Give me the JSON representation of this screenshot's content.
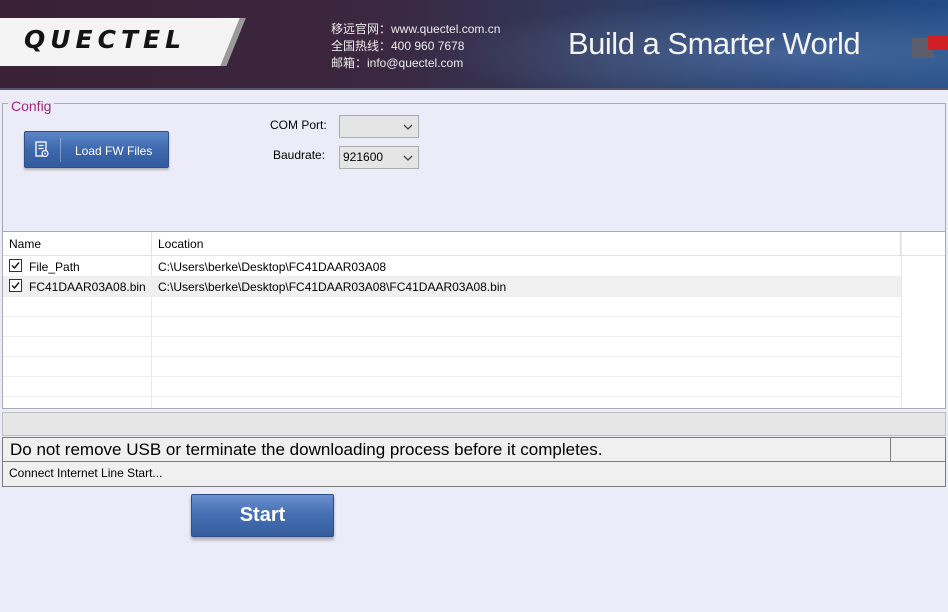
{
  "banner": {
    "logo_text": "QUECTEL",
    "contact": [
      "移远官网：www.quectel.com.cn",
      "全国热线：400 960 7678",
      "邮箱：info@quectel.com"
    ],
    "slogan": "Build a Smarter World"
  },
  "config": {
    "title": "Config",
    "load_button_label": "Load FW Files",
    "load_icon": "document-settings-icon",
    "com_port_label": "COM Port:",
    "com_port_value": "",
    "baudrate_label": "Baudrate:",
    "baudrate_value": "921600"
  },
  "table": {
    "columns": [
      "Name",
      "Location"
    ],
    "rows": [
      {
        "checked": true,
        "name": "File_Path",
        "location": "C:\\Users\\berke\\Desktop\\FC41DAAR03A08"
      },
      {
        "checked": true,
        "name": "FC41DAAR03A08.bin",
        "location": "C:\\Users\\berke\\Desktop\\FC41DAAR03A08\\FC41DAAR03A08.bin"
      }
    ]
  },
  "status": {
    "progress": 0,
    "warning": "Do not remove USB or terminate the downloading process before it completes.",
    "log": "Connect Internet Line Start..."
  },
  "start_button_label": "Start",
  "colors": {
    "accent_button": "#3d68ad",
    "legend": "#a0287d",
    "background": "#ececf8"
  }
}
